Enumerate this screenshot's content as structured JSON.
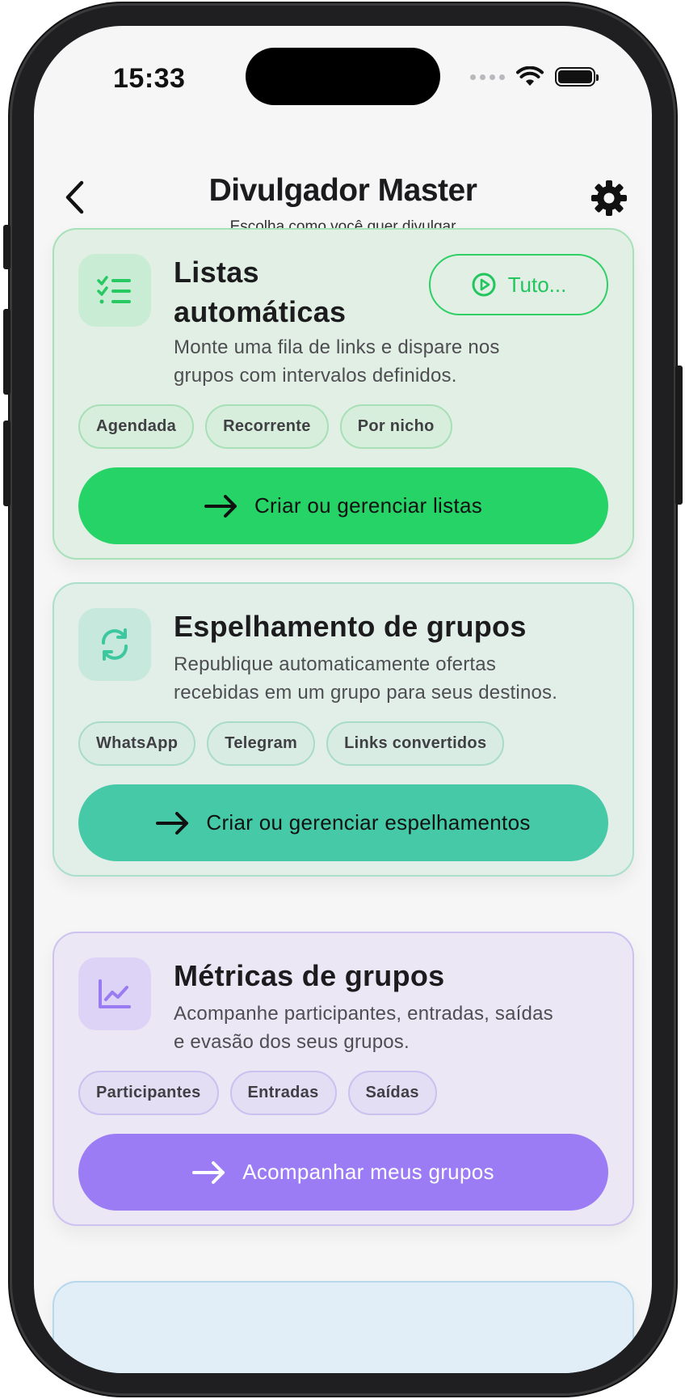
{
  "status_bar": {
    "time": "15:33"
  },
  "header": {
    "title": "Divulgador Master",
    "subtitle": "Escolha como você quer divulgar"
  },
  "cards": [
    {
      "title_line1": "Listas",
      "title_line2": "automáticas",
      "tutorial_label": "Tuto...",
      "description_line1": "Monte uma fila de links e dispare nos",
      "description_line2": "grupos com intervalos definidos.",
      "chips": [
        "Agendada",
        "Recorrente",
        "Por nicho"
      ],
      "action_label": "Criar ou gerenciar listas",
      "accent": "#26d366"
    },
    {
      "title": "Espelhamento de grupos",
      "description_line1": "Republique automaticamente ofertas",
      "description_line2": "recebidas em um grupo para seus destinos.",
      "chips": [
        "WhatsApp",
        "Telegram",
        "Links convertidos"
      ],
      "action_label": "Criar ou gerenciar espelhamentos",
      "accent": "#45c9a6"
    },
    {
      "title": "Métricas de grupos",
      "description_line1": "Acompanhe participantes, entradas, saídas",
      "description_line2": "e evasão dos seus grupos.",
      "chips": [
        "Participantes",
        "Entradas",
        "Saídas"
      ],
      "action_label": "Acompanhar meus grupos",
      "accent": "#9c7cf5"
    }
  ],
  "icons": {
    "back": "chevron-left-icon",
    "settings": "gear-icon",
    "card1": "checklist-icon",
    "card2": "refresh-icon",
    "card3": "line-chart-icon"
  }
}
